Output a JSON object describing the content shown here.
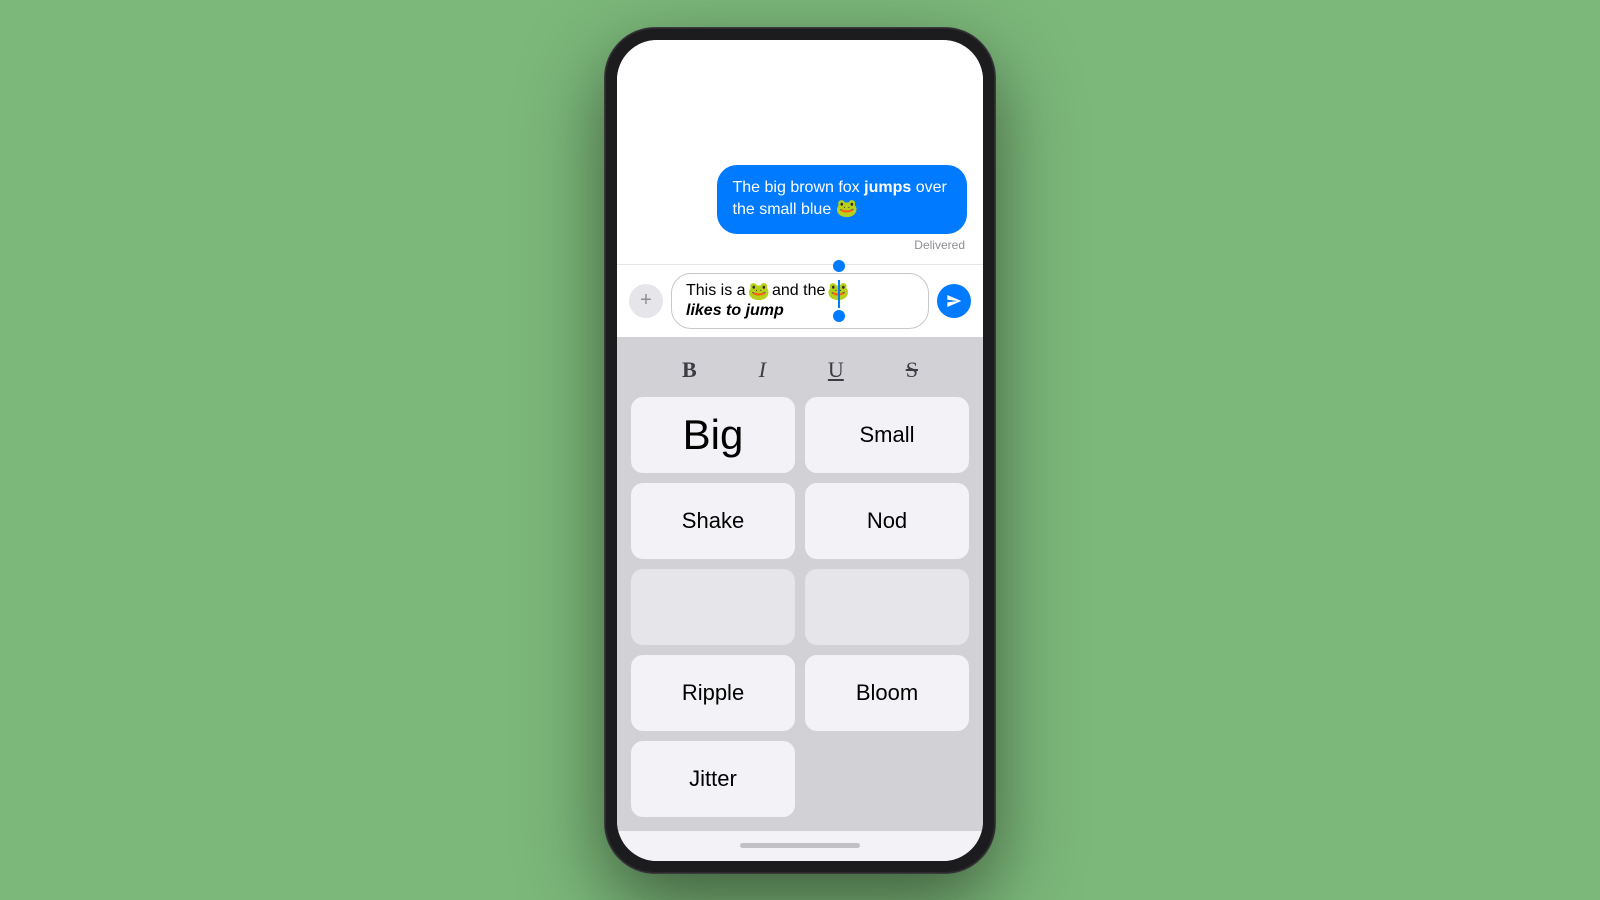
{
  "background_color": "#7cb87a",
  "phone": {
    "message_bubble": {
      "text_before_bold": "The big brown fox ",
      "bold_text": "jumps",
      "text_after_bold": " over the small blue ",
      "emoji": "🐸"
    },
    "delivered_label": "Delivered",
    "input_bar": {
      "add_button_label": "+",
      "input_text_part1": "This is a ",
      "input_emoji1": "🐸",
      "input_text_part2": " and the ",
      "input_emoji2": "🐸",
      "input_text_italic": " likes to jump",
      "send_icon": "send-icon"
    },
    "format_toolbar": {
      "bold_label": "B",
      "italic_label": "I",
      "underline_label": "U",
      "strikethrough_label": "S"
    },
    "effects_grid": [
      {
        "label": "Big",
        "size": "big",
        "col": 1
      },
      {
        "label": "Small",
        "size": "normal",
        "col": 2
      },
      {
        "label": "Shake",
        "size": "normal",
        "col": 1
      },
      {
        "label": "Nod",
        "size": "normal",
        "col": 2
      },
      {
        "label": "",
        "size": "empty",
        "col": 1
      },
      {
        "label": "",
        "size": "empty",
        "col": 1.5
      },
      {
        "label": "Ripple",
        "size": "normal",
        "col": 2
      },
      {
        "label": "Bloom",
        "size": "normal",
        "col": 1
      },
      {
        "label": "Jitter",
        "size": "normal",
        "col": 2
      }
    ]
  }
}
